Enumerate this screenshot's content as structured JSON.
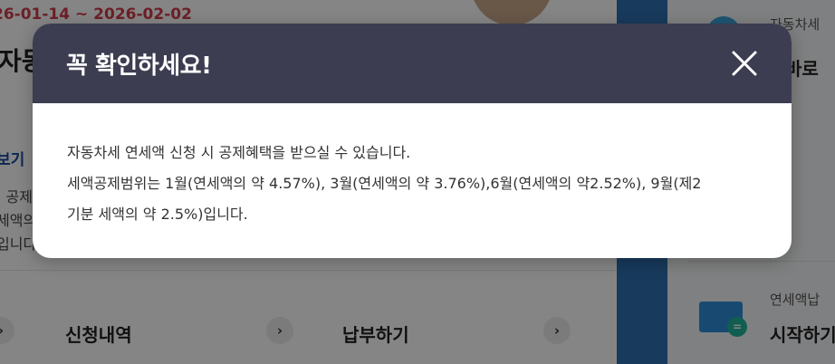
{
  "background": {
    "date_range": "26-01-14 ~ 2026-02-02",
    "title_fragment": "자동",
    "link_fragment": "보기",
    "text_fragments": [
      "| 공제",
      "세액의",
      "입니다"
    ],
    "cards": [
      {
        "title": "신청내역"
      },
      {
        "title": "납부하기"
      }
    ],
    "right_panel": {
      "item1_small": "자동차세",
      "item1_big": "Q바로",
      "item2_small": "연세액납",
      "item2_big": "시작하기"
    }
  },
  "modal": {
    "title": "꼭 확인하세요!",
    "close_icon": "close-icon",
    "body_lines": [
      "자동차세 연세액 신청 시 공제혜택을 받으실 수 있습니다.",
      "세액공제범위는 1월(연세액의 약 4.57%), 3월(연세액의 약 3.76%),6월(연세액의 약2.52%), 9월(제2",
      "기분 세액의 약 2.5%)입니다."
    ]
  },
  "colors": {
    "modal_header": "#3c3d51",
    "date_accent": "#d23c4c",
    "link_blue": "#1a4ba0",
    "band_blue": "#2f6fb0"
  }
}
